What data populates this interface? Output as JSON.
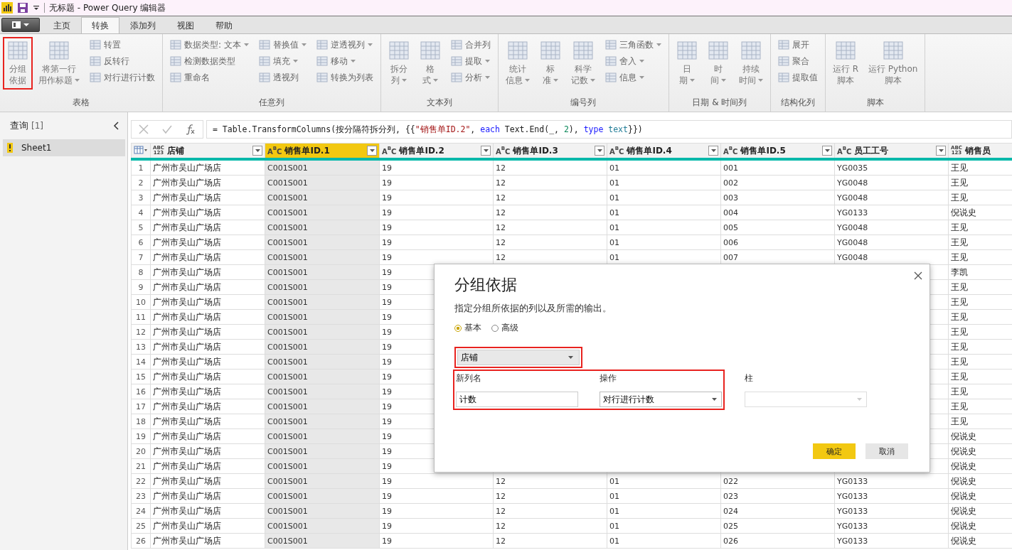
{
  "window": {
    "title": "无标题 - Power Query 编辑器"
  },
  "tabs": [
    {
      "label": "主页",
      "selected": false
    },
    {
      "label": "转换",
      "selected": true
    },
    {
      "label": "添加列",
      "selected": false
    },
    {
      "label": "视图",
      "selected": false
    },
    {
      "label": "帮助",
      "selected": false
    }
  ],
  "ribbon": [
    {
      "label": "表格",
      "items": [
        {
          "kind": "large",
          "lines": [
            "分组",
            "依据"
          ],
          "dropdown": false,
          "highlighted": true
        },
        {
          "kind": "large",
          "lines": [
            "将第一行",
            "用作标题"
          ],
          "dropdown": true,
          "highlighted": false
        },
        {
          "kind": "column",
          "items": [
            {
              "label": "转置",
              "dropdown": false
            },
            {
              "label": "反转行",
              "dropdown": false
            },
            {
              "label": "对行进行计数",
              "dropdown": false
            }
          ]
        }
      ]
    },
    {
      "label": "任意列",
      "items": [
        {
          "kind": "column",
          "items": [
            {
              "label": "数据类型: 文本",
              "dropdown": true
            },
            {
              "label": "检测数据类型",
              "dropdown": false
            },
            {
              "label": "重命名",
              "dropdown": false
            }
          ]
        },
        {
          "kind": "column",
          "items": [
            {
              "label": "替换值",
              "dropdown": true
            },
            {
              "label": "填充",
              "dropdown": true
            },
            {
              "label": "透视列",
              "dropdown": false
            }
          ]
        },
        {
          "kind": "column",
          "items": [
            {
              "label": "逆透视列",
              "dropdown": true
            },
            {
              "label": "移动",
              "dropdown": true
            },
            {
              "label": "转换为列表",
              "dropdown": false
            }
          ]
        }
      ]
    },
    {
      "label": "文本列",
      "items": [
        {
          "kind": "large",
          "lines": [
            "拆分",
            "列"
          ],
          "dropdown": true,
          "highlighted": false
        },
        {
          "kind": "large",
          "lines": [
            "格",
            "式"
          ],
          "dropdown": true,
          "highlighted": false
        },
        {
          "kind": "column",
          "items": [
            {
              "label": "合并列",
              "dropdown": false
            },
            {
              "label": "提取",
              "dropdown": true
            },
            {
              "label": "分析",
              "dropdown": true
            }
          ]
        }
      ]
    },
    {
      "label": "编号列",
      "items": [
        {
          "kind": "large",
          "lines": [
            "统计",
            "信息"
          ],
          "dropdown": true,
          "highlighted": false
        },
        {
          "kind": "large",
          "lines": [
            "标",
            "准"
          ],
          "dropdown": true,
          "highlighted": false
        },
        {
          "kind": "large",
          "lines": [
            "科学",
            "记数"
          ],
          "dropdown": true,
          "highlighted": false
        },
        {
          "kind": "column",
          "items": [
            {
              "label": "三角函数",
              "dropdown": true
            },
            {
              "label": "舍入",
              "dropdown": true
            },
            {
              "label": "信息",
              "dropdown": true
            }
          ]
        }
      ]
    },
    {
      "label": "日期 & 时间列",
      "items": [
        {
          "kind": "large",
          "lines": [
            "日",
            "期"
          ],
          "dropdown": true,
          "highlighted": false
        },
        {
          "kind": "large",
          "lines": [
            "时",
            "间"
          ],
          "dropdown": true,
          "highlighted": false
        },
        {
          "kind": "large",
          "lines": [
            "持续",
            "时间"
          ],
          "dropdown": true,
          "highlighted": false
        }
      ]
    },
    {
      "label": "结构化列",
      "items": [
        {
          "kind": "column",
          "items": [
            {
              "label": "展开",
              "dropdown": false
            },
            {
              "label": "聚合",
              "dropdown": false
            },
            {
              "label": "提取值",
              "dropdown": false
            }
          ]
        }
      ]
    },
    {
      "label": "脚本",
      "items": [
        {
          "kind": "large",
          "lines": [
            "运行 R",
            "脚本"
          ],
          "dropdown": false,
          "highlighted": false
        },
        {
          "kind": "large",
          "lines": [
            "运行 Python",
            "脚本"
          ],
          "dropdown": false,
          "highlighted": false
        }
      ]
    }
  ],
  "queries": {
    "title": "查询",
    "count": "[1]",
    "items": [
      {
        "label": "Sheet1",
        "selected": true
      }
    ]
  },
  "formula": [
    {
      "kind": "plain",
      "text": "= Table.TransformColumns(按分隔符拆分列, {{"
    },
    {
      "kind": "string",
      "text": "\"销售单ID.2\""
    },
    {
      "kind": "plain",
      "text": ", "
    },
    {
      "kind": "keyword",
      "text": "each"
    },
    {
      "kind": "plain",
      "text": " Text.End(_, "
    },
    {
      "kind": "number",
      "text": "2"
    },
    {
      "kind": "plain",
      "text": "), "
    },
    {
      "kind": "keyword",
      "text": "type"
    },
    {
      "kind": "type",
      "text": " text"
    },
    {
      "kind": "plain",
      "text": "}})"
    }
  ],
  "table": {
    "columns": [
      {
        "name": "店铺",
        "type_icon": [
          "ABC",
          "123"
        ],
        "selected": false
      },
      {
        "name": "销售单ID.1",
        "type_icon": [
          "A",
          "B",
          "C"
        ],
        "selected": true
      },
      {
        "name": "销售单ID.2",
        "type_icon": [
          "A",
          "B",
          "C"
        ],
        "selected": false
      },
      {
        "name": "销售单ID.3",
        "type_icon": [
          "A",
          "B",
          "C"
        ],
        "selected": false
      },
      {
        "name": "销售单ID.4",
        "type_icon": [
          "A",
          "B",
          "C"
        ],
        "selected": false
      },
      {
        "name": "销售单ID.5",
        "type_icon": [
          "A",
          "B",
          "C"
        ],
        "selected": false
      },
      {
        "name": "员工工号",
        "type_icon": [
          "A",
          "B",
          "C"
        ],
        "selected": false
      },
      {
        "name": "销售员",
        "type_icon": [
          "ABC",
          "123"
        ],
        "selected": false
      }
    ],
    "rows": [
      {
        "num": "1",
        "cells": [
          "广州市吴山广场店",
          "C001S001",
          "19",
          "12",
          "01",
          "001",
          "YG0035",
          "王见"
        ]
      },
      {
        "num": "2",
        "cells": [
          "广州市吴山广场店",
          "C001S001",
          "19",
          "12",
          "01",
          "002",
          "YG0048",
          "王见"
        ]
      },
      {
        "num": "3",
        "cells": [
          "广州市吴山广场店",
          "C001S001",
          "19",
          "12",
          "01",
          "003",
          "YG0048",
          "王见"
        ]
      },
      {
        "num": "4",
        "cells": [
          "广州市吴山广场店",
          "C001S001",
          "19",
          "12",
          "01",
          "004",
          "YG0133",
          "倪说史"
        ]
      },
      {
        "num": "5",
        "cells": [
          "广州市吴山广场店",
          "C001S001",
          "19",
          "12",
          "01",
          "005",
          "YG0048",
          "王见"
        ]
      },
      {
        "num": "6",
        "cells": [
          "广州市吴山广场店",
          "C001S001",
          "19",
          "12",
          "01",
          "006",
          "YG0048",
          "王见"
        ]
      },
      {
        "num": "7",
        "cells": [
          "广州市吴山广场店",
          "C001S001",
          "19",
          "12",
          "01",
          "007",
          "YG0048",
          "王见"
        ]
      },
      {
        "num": "8",
        "cells": [
          "广州市吴山广场店",
          "C001S001",
          "19",
          null,
          null,
          null,
          null,
          "李凯"
        ]
      },
      {
        "num": "9",
        "cells": [
          "广州市吴山广场店",
          "C001S001",
          "19",
          null,
          null,
          null,
          null,
          "王见"
        ]
      },
      {
        "num": "10",
        "cells": [
          "广州市吴山广场店",
          "C001S001",
          "19",
          null,
          null,
          null,
          null,
          "王见"
        ]
      },
      {
        "num": "11",
        "cells": [
          "广州市吴山广场店",
          "C001S001",
          "19",
          null,
          null,
          null,
          null,
          "王见"
        ]
      },
      {
        "num": "12",
        "cells": [
          "广州市吴山广场店",
          "C001S001",
          "19",
          null,
          null,
          null,
          null,
          "王见"
        ]
      },
      {
        "num": "13",
        "cells": [
          "广州市吴山广场店",
          "C001S001",
          "19",
          null,
          null,
          null,
          null,
          "王见"
        ]
      },
      {
        "num": "14",
        "cells": [
          "广州市吴山广场店",
          "C001S001",
          "19",
          null,
          null,
          null,
          null,
          "王见"
        ]
      },
      {
        "num": "15",
        "cells": [
          "广州市吴山广场店",
          "C001S001",
          "19",
          null,
          null,
          null,
          null,
          "王见"
        ]
      },
      {
        "num": "16",
        "cells": [
          "广州市吴山广场店",
          "C001S001",
          "19",
          null,
          null,
          null,
          null,
          "王见"
        ]
      },
      {
        "num": "17",
        "cells": [
          "广州市吴山广场店",
          "C001S001",
          "19",
          null,
          null,
          null,
          null,
          "王见"
        ]
      },
      {
        "num": "18",
        "cells": [
          "广州市吴山广场店",
          "C001S001",
          "19",
          null,
          null,
          null,
          null,
          "王见"
        ]
      },
      {
        "num": "19",
        "cells": [
          "广州市吴山广场店",
          "C001S001",
          "19",
          null,
          null,
          null,
          null,
          "倪说史"
        ]
      },
      {
        "num": "20",
        "cells": [
          "广州市吴山广场店",
          "C001S001",
          "19",
          null,
          null,
          null,
          null,
          "倪说史"
        ]
      },
      {
        "num": "21",
        "cells": [
          "广州市吴山广场店",
          "C001S001",
          "19",
          null,
          null,
          null,
          null,
          "倪说史"
        ]
      },
      {
        "num": "22",
        "cells": [
          "广州市吴山广场店",
          "C001S001",
          "19",
          "12",
          "01",
          "022",
          "YG0133",
          "倪说史"
        ]
      },
      {
        "num": "23",
        "cells": [
          "广州市吴山广场店",
          "C001S001",
          "19",
          "12",
          "01",
          "023",
          "YG0133",
          "倪说史"
        ]
      },
      {
        "num": "24",
        "cells": [
          "广州市吴山广场店",
          "C001S001",
          "19",
          "12",
          "01",
          "024",
          "YG0133",
          "倪说史"
        ]
      },
      {
        "num": "25",
        "cells": [
          "广州市吴山广场店",
          "C001S001",
          "19",
          "12",
          "01",
          "025",
          "YG0133",
          "倪说史"
        ]
      },
      {
        "num": "26",
        "cells": [
          "广州市吴山广场店",
          "C001S001",
          "19",
          "12",
          "01",
          "026",
          "YG0133",
          "倪说史"
        ]
      }
    ]
  },
  "dialog": {
    "title": "分组依据",
    "description": "指定分组所依据的列以及所需的输出。",
    "modes": [
      {
        "label": "基本",
        "selected": true
      },
      {
        "label": "高级",
        "selected": false
      }
    ],
    "group_by": {
      "value": "店铺",
      "highlighted": true
    },
    "aggregation": {
      "highlighted": true,
      "new_column_label": "新列名",
      "new_column_value": "计数",
      "operation_label": "操作",
      "operation_value": "对行进行计数",
      "column_label": "柱"
    },
    "buttons": [
      {
        "label": "确定",
        "kind": "primary"
      },
      {
        "label": "取消",
        "kind": "secondary"
      }
    ]
  }
}
